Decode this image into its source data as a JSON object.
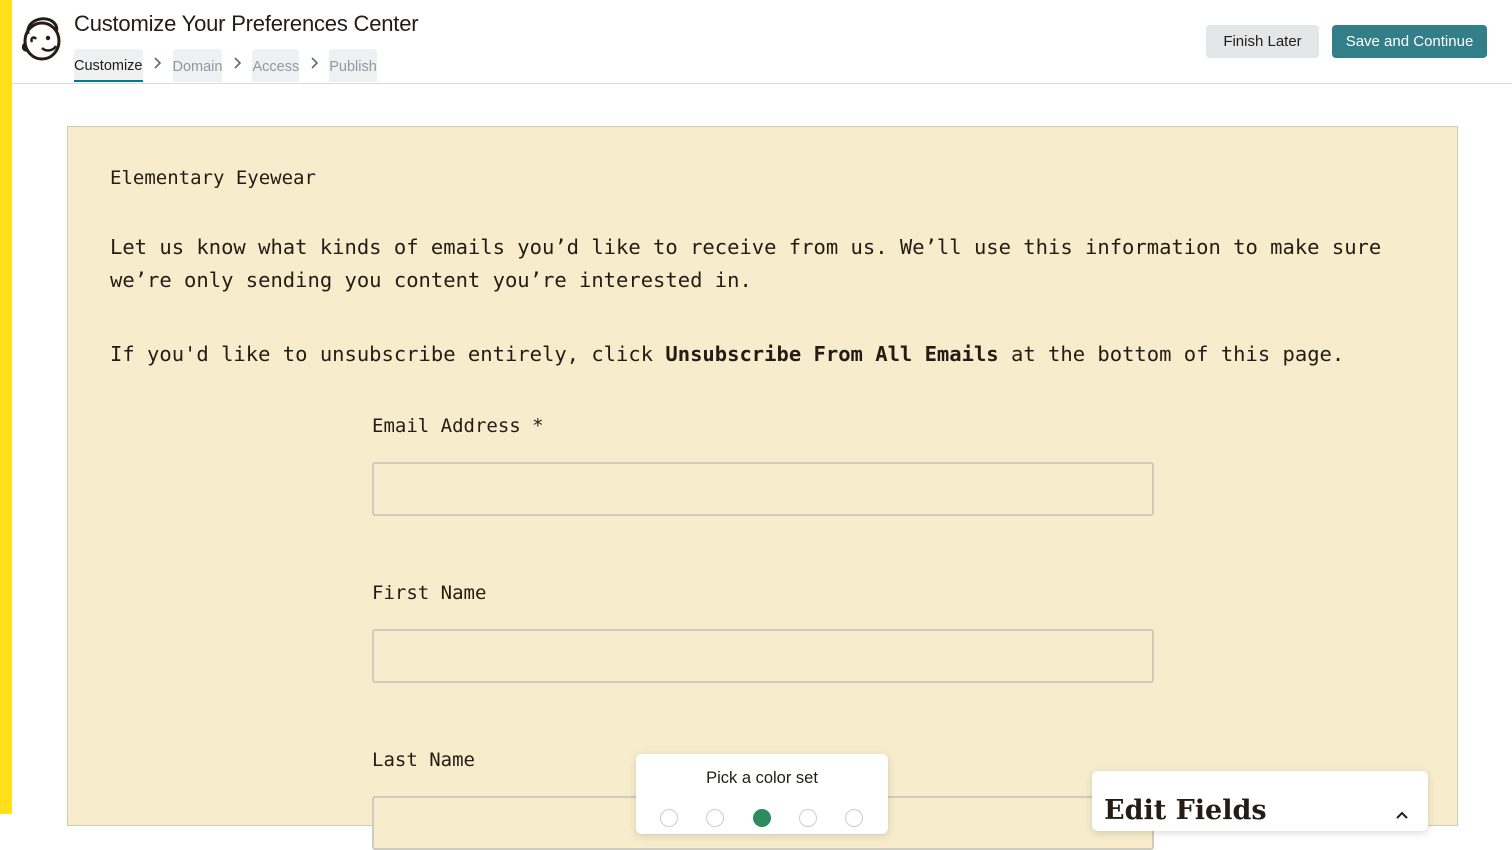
{
  "header": {
    "title": "Customize Your Preferences Center",
    "steps": [
      {
        "label": "Customize",
        "active": true
      },
      {
        "label": "Domain",
        "active": false
      },
      {
        "label": "Access",
        "active": false
      },
      {
        "label": "Publish",
        "active": false
      }
    ],
    "finish_later_label": "Finish Later",
    "save_continue_label": "Save and Continue"
  },
  "colors": {
    "accent_bar": "#ffe01b",
    "primary_button": "#337f89",
    "canvas_background": "#f7edcd",
    "active_step_underline": "#007c89",
    "selected_swatch": "#2e8a5f"
  },
  "preview": {
    "org_name": "Elementary Eyewear",
    "intro": "Let us know what kinds of emails you’d like to receive from us. We’ll use this information to make sure we’re only sending you content you’re interested in.",
    "unsub_prefix": "If you'd like to unsubscribe entirely, click ",
    "unsub_strong": "Unsubscribe From All Emails",
    "unsub_suffix": " at the bottom of this page.",
    "fields": [
      {
        "label": "Email Address *",
        "value": ""
      },
      {
        "label": "First Name",
        "value": ""
      },
      {
        "label": "Last Name",
        "value": ""
      }
    ]
  },
  "color_picker": {
    "title": "Pick a color set",
    "swatches": [
      {
        "selected": false
      },
      {
        "selected": false
      },
      {
        "selected": true
      },
      {
        "selected": false
      },
      {
        "selected": false
      }
    ]
  },
  "edit_panel": {
    "title": "Edit Fields"
  },
  "icons": {
    "logo": "mailchimp-freddie-icon",
    "step_separator": "chevron-right-icon",
    "panel_toggle": "chevron-up-icon"
  }
}
